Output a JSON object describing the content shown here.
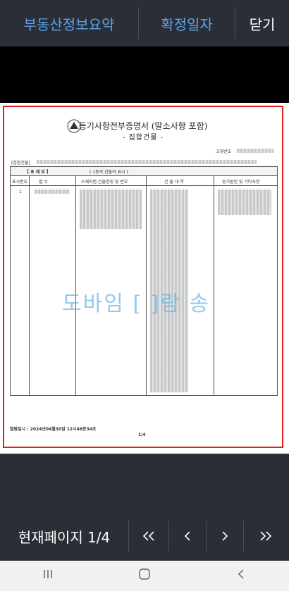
{
  "top_bar": {
    "summary_label": "부동산정보요약",
    "confirm_date_label": "확정일자",
    "close_label": "닫기"
  },
  "document": {
    "title": "등기사항전부증명서 (말소사항 포함)",
    "subtitle": "- 집합건물 -",
    "unique_no_label": "고유번호",
    "building_label": "[집합건물]",
    "section_header": "【 표 제 부 】",
    "section_sub": "( 1동의 건물의 표시 )",
    "columns": [
      "표시번호",
      "접 수",
      "소재지번,건물명칭 및 번호",
      "건 물 내 역",
      "등기원인 및 기타사항"
    ],
    "row_no": "1",
    "watermark": "도바임 [ ]람 송",
    "issued_text": "열람일시 : 2024년04월30일 12시46분34초",
    "page_text": "1/4"
  },
  "pager": {
    "current_page_label": "현재페이지 1/4",
    "first_icon": "double-chevron-left",
    "prev_icon": "chevron-left",
    "next_icon": "chevron-right",
    "last_icon": "double-chevron-right"
  },
  "system_nav": {
    "recents_icon": "recents",
    "home_icon": "home",
    "back_icon": "back"
  }
}
